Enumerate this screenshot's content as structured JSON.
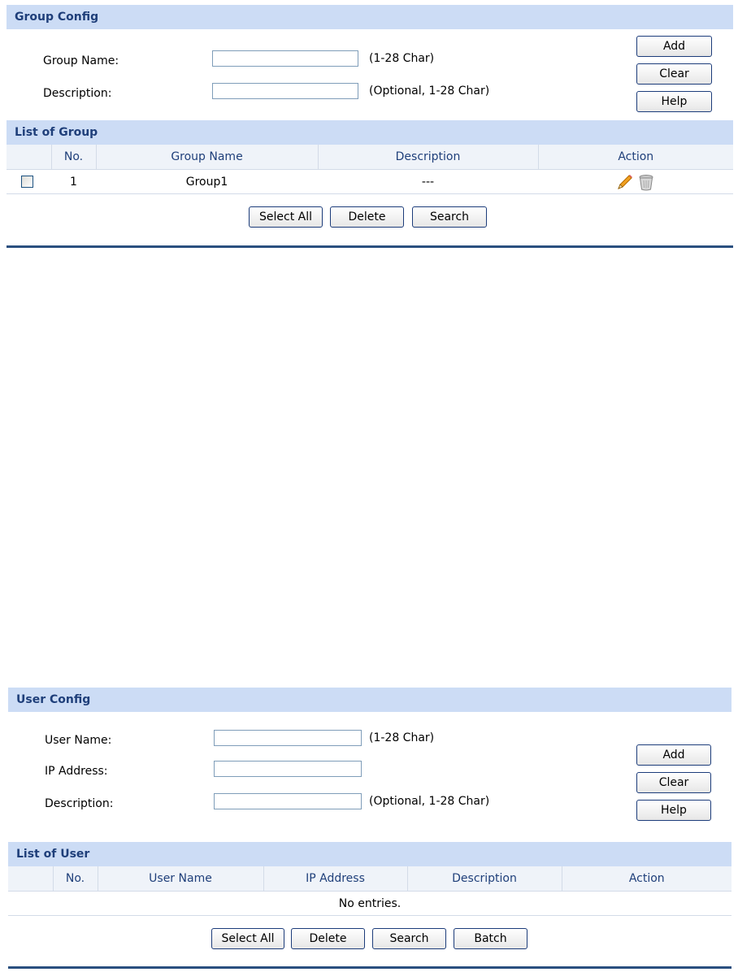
{
  "group_config": {
    "header": "Group Config",
    "group_name_label": "Group Name:",
    "group_name_value": "",
    "group_name_hint": "(1-28 Char)",
    "description_label": "Description:",
    "description_value": "",
    "description_hint": "(Optional, 1-28 Char)",
    "add_label": "Add",
    "clear_label": "Clear",
    "help_label": "Help"
  },
  "group_list": {
    "header": "List of Group",
    "columns": [
      "",
      "No.",
      "Group Name",
      "Description",
      "Action"
    ],
    "rows": [
      {
        "no": "1",
        "group_name": "Group1",
        "description": "---",
        "actions": [
          "edit-icon",
          "delete-icon"
        ]
      }
    ],
    "select_all_label": "Select All",
    "delete_label": "Delete",
    "search_label": "Search"
  },
  "user_config": {
    "header": "User Config",
    "user_name_label": "User Name:",
    "user_name_value": "",
    "user_name_hint": "(1-28 Char)",
    "ip_address_label": "IP Address:",
    "ip_address_value": "",
    "description_label": "Description:",
    "description_value": "",
    "description_hint": "(Optional, 1-28 Char)",
    "add_label": "Add",
    "clear_label": "Clear",
    "help_label": "Help"
  },
  "user_list": {
    "header": "List of User",
    "columns": [
      "",
      "No.",
      "User Name",
      "IP Address",
      "Description",
      "Action"
    ],
    "empty_text": "No entries.",
    "select_all_label": "Select All",
    "delete_label": "Delete",
    "search_label": "Search",
    "batch_label": "Batch"
  },
  "colors": {
    "header_bg": "#ccdcf5",
    "header_text": "#1f3f7a",
    "table_header_bg": "#eff3f9",
    "rule": "#2a4f7f"
  }
}
